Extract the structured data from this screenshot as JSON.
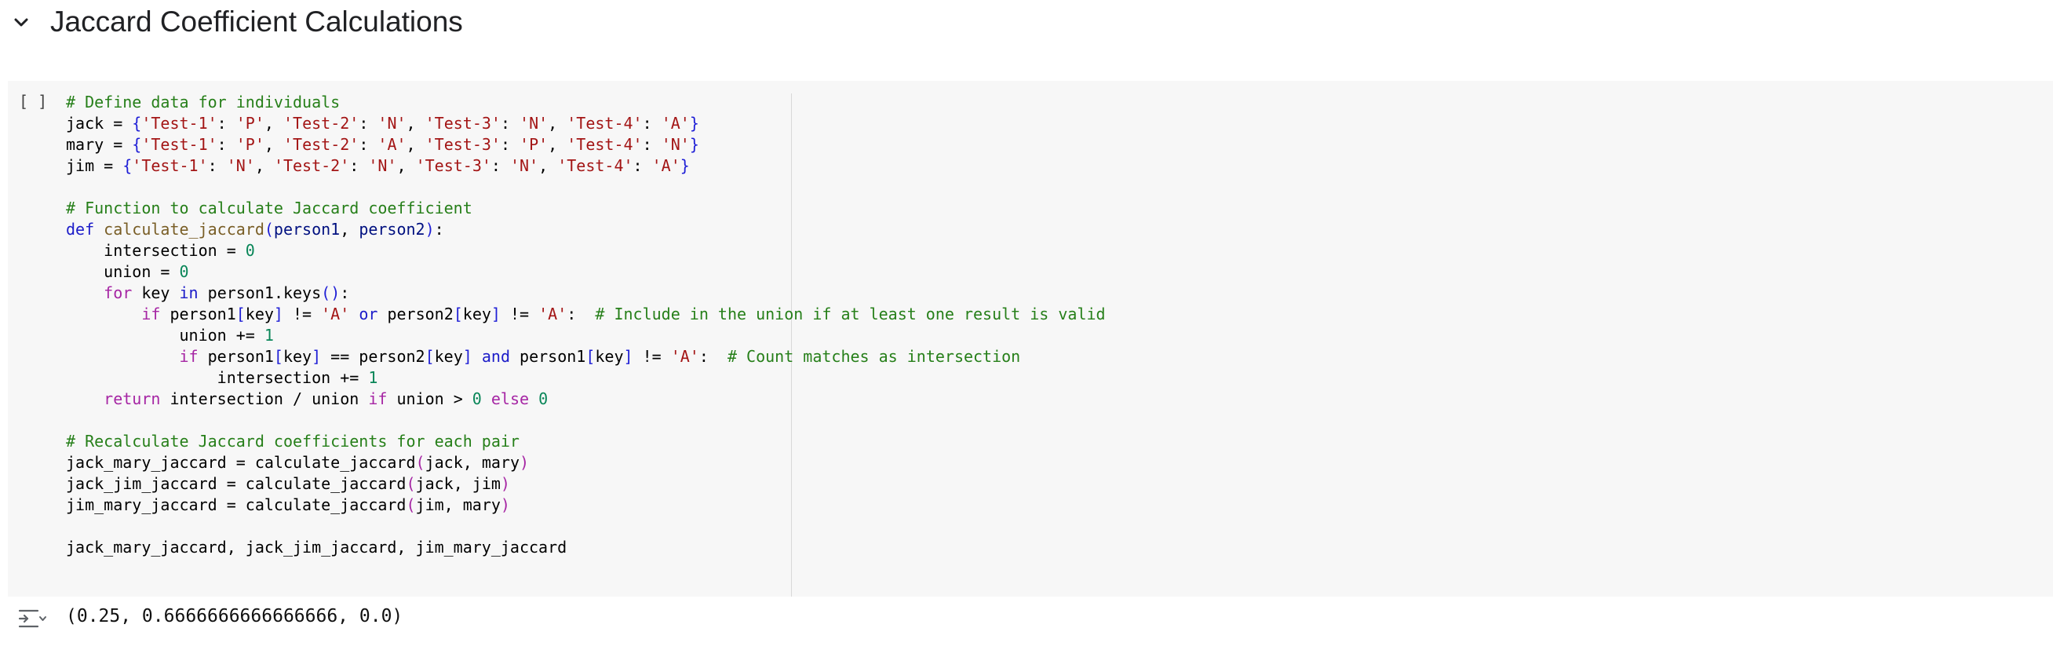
{
  "section": {
    "title": "Jaccard Coefficient Calculations",
    "toggle_icon": "chevron-down-icon"
  },
  "cell": {
    "run_indicator": "[ ]",
    "lines": [
      [
        [
          "comment",
          "# Define data for individuals"
        ]
      ],
      [
        [
          "plain",
          "jack = "
        ],
        [
          "brk1",
          "{"
        ],
        [
          "str",
          "'Test-1'"
        ],
        [
          "plain",
          ": "
        ],
        [
          "str",
          "'P'"
        ],
        [
          "plain",
          ", "
        ],
        [
          "str",
          "'Test-2'"
        ],
        [
          "plain",
          ": "
        ],
        [
          "str",
          "'N'"
        ],
        [
          "plain",
          ", "
        ],
        [
          "str",
          "'Test-3'"
        ],
        [
          "plain",
          ": "
        ],
        [
          "str",
          "'N'"
        ],
        [
          "plain",
          ", "
        ],
        [
          "str",
          "'Test-4'"
        ],
        [
          "plain",
          ": "
        ],
        [
          "str",
          "'A'"
        ],
        [
          "brk1",
          "}"
        ]
      ],
      [
        [
          "plain",
          "mary = "
        ],
        [
          "brk1",
          "{"
        ],
        [
          "str",
          "'Test-1'"
        ],
        [
          "plain",
          ": "
        ],
        [
          "str",
          "'P'"
        ],
        [
          "plain",
          ", "
        ],
        [
          "str",
          "'Test-2'"
        ],
        [
          "plain",
          ": "
        ],
        [
          "str",
          "'A'"
        ],
        [
          "plain",
          ", "
        ],
        [
          "str",
          "'Test-3'"
        ],
        [
          "plain",
          ": "
        ],
        [
          "str",
          "'P'"
        ],
        [
          "plain",
          ", "
        ],
        [
          "str",
          "'Test-4'"
        ],
        [
          "plain",
          ": "
        ],
        [
          "str",
          "'N'"
        ],
        [
          "brk1",
          "}"
        ]
      ],
      [
        [
          "plain",
          "jim = "
        ],
        [
          "brk1",
          "{"
        ],
        [
          "str",
          "'Test-1'"
        ],
        [
          "plain",
          ": "
        ],
        [
          "str",
          "'N'"
        ],
        [
          "plain",
          ", "
        ],
        [
          "str",
          "'Test-2'"
        ],
        [
          "plain",
          ": "
        ],
        [
          "str",
          "'N'"
        ],
        [
          "plain",
          ", "
        ],
        [
          "str",
          "'Test-3'"
        ],
        [
          "plain",
          ": "
        ],
        [
          "str",
          "'N'"
        ],
        [
          "plain",
          ", "
        ],
        [
          "str",
          "'Test-4'"
        ],
        [
          "plain",
          ": "
        ],
        [
          "str",
          "'A'"
        ],
        [
          "brk1",
          "}"
        ]
      ],
      [],
      [
        [
          "comment",
          "# Function to calculate Jaccard coefficient"
        ]
      ],
      [
        [
          "def",
          "def "
        ],
        [
          "fn",
          "calculate_jaccard"
        ],
        [
          "brk1",
          "("
        ],
        [
          "param",
          "person1"
        ],
        [
          "plain",
          ", "
        ],
        [
          "param",
          "person2"
        ],
        [
          "brk1",
          ")"
        ],
        [
          "plain",
          ":"
        ]
      ],
      [
        [
          "plain",
          "    intersection = "
        ],
        [
          "num",
          "0"
        ]
      ],
      [
        [
          "plain",
          "    union = "
        ],
        [
          "num",
          "0"
        ]
      ],
      [
        [
          "plain",
          "    "
        ],
        [
          "keyword",
          "for"
        ],
        [
          "plain",
          " key "
        ],
        [
          "def",
          "in"
        ],
        [
          "plain",
          " person1.keys"
        ],
        [
          "brk1",
          "()"
        ],
        [
          "plain",
          ":"
        ]
      ],
      [
        [
          "plain",
          "        "
        ],
        [
          "keyword",
          "if"
        ],
        [
          "plain",
          " person1"
        ],
        [
          "brk1",
          "["
        ],
        [
          "plain",
          "key"
        ],
        [
          "brk1",
          "]"
        ],
        [
          "plain",
          " != "
        ],
        [
          "str",
          "'A'"
        ],
        [
          "plain",
          " "
        ],
        [
          "def",
          "or"
        ],
        [
          "plain",
          " person2"
        ],
        [
          "brk1",
          "["
        ],
        [
          "plain",
          "key"
        ],
        [
          "brk1",
          "]"
        ],
        [
          "plain",
          " != "
        ],
        [
          "str",
          "'A'"
        ],
        [
          "plain",
          ":  "
        ],
        [
          "comment",
          "# Include in the union if at least one result is valid"
        ]
      ],
      [
        [
          "plain",
          "            union += "
        ],
        [
          "num",
          "1"
        ]
      ],
      [
        [
          "plain",
          "            "
        ],
        [
          "keyword",
          "if"
        ],
        [
          "plain",
          " person1"
        ],
        [
          "brk1",
          "["
        ],
        [
          "plain",
          "key"
        ],
        [
          "brk1",
          "]"
        ],
        [
          "plain",
          " == person2"
        ],
        [
          "brk1",
          "["
        ],
        [
          "plain",
          "key"
        ],
        [
          "brk1",
          "]"
        ],
        [
          "plain",
          " "
        ],
        [
          "def",
          "and"
        ],
        [
          "plain",
          " person1"
        ],
        [
          "brk1",
          "["
        ],
        [
          "plain",
          "key"
        ],
        [
          "brk1",
          "]"
        ],
        [
          "plain",
          " != "
        ],
        [
          "str",
          "'A'"
        ],
        [
          "plain",
          ":  "
        ],
        [
          "comment",
          "# Count matches as intersection"
        ]
      ],
      [
        [
          "plain",
          "                intersection += "
        ],
        [
          "num",
          "1"
        ]
      ],
      [
        [
          "plain",
          "    "
        ],
        [
          "keyword",
          "return"
        ],
        [
          "plain",
          " intersection / union "
        ],
        [
          "keyword",
          "if"
        ],
        [
          "plain",
          " union > "
        ],
        [
          "num",
          "0"
        ],
        [
          "plain",
          " "
        ],
        [
          "keyword",
          "else"
        ],
        [
          "plain",
          " "
        ],
        [
          "num",
          "0"
        ]
      ],
      [],
      [
        [
          "comment",
          "# Recalculate Jaccard coefficients for each pair"
        ]
      ],
      [
        [
          "plain",
          "jack_mary_jaccard = calculate_jaccard"
        ],
        [
          "brk2",
          "("
        ],
        [
          "plain",
          "jack, mary"
        ],
        [
          "brk2",
          ")"
        ]
      ],
      [
        [
          "plain",
          "jack_jim_jaccard = calculate_jaccard"
        ],
        [
          "brk2",
          "("
        ],
        [
          "plain",
          "jack, jim"
        ],
        [
          "brk2",
          ")"
        ]
      ],
      [
        [
          "plain",
          "jim_mary_jaccard = calculate_jaccard"
        ],
        [
          "brk2",
          "("
        ],
        [
          "plain",
          "jim, mary"
        ],
        [
          "brk2",
          ")"
        ]
      ],
      [],
      [
        [
          "plain",
          "jack_mary_jaccard, jack_jim_jaccard, jim_mary_jaccard"
        ]
      ]
    ]
  },
  "output": {
    "icon": "output-toggle-icon",
    "text": "(0.25, 0.6666666666666666, 0.0)"
  },
  "colors": {
    "comment": "#267f19",
    "keyword": "#a626a4",
    "def": "#1c1cc9",
    "function": "#795e26",
    "string": "#a31515",
    "number": "#098658",
    "param": "#001080",
    "cell_bg": "#f7f7f7"
  }
}
